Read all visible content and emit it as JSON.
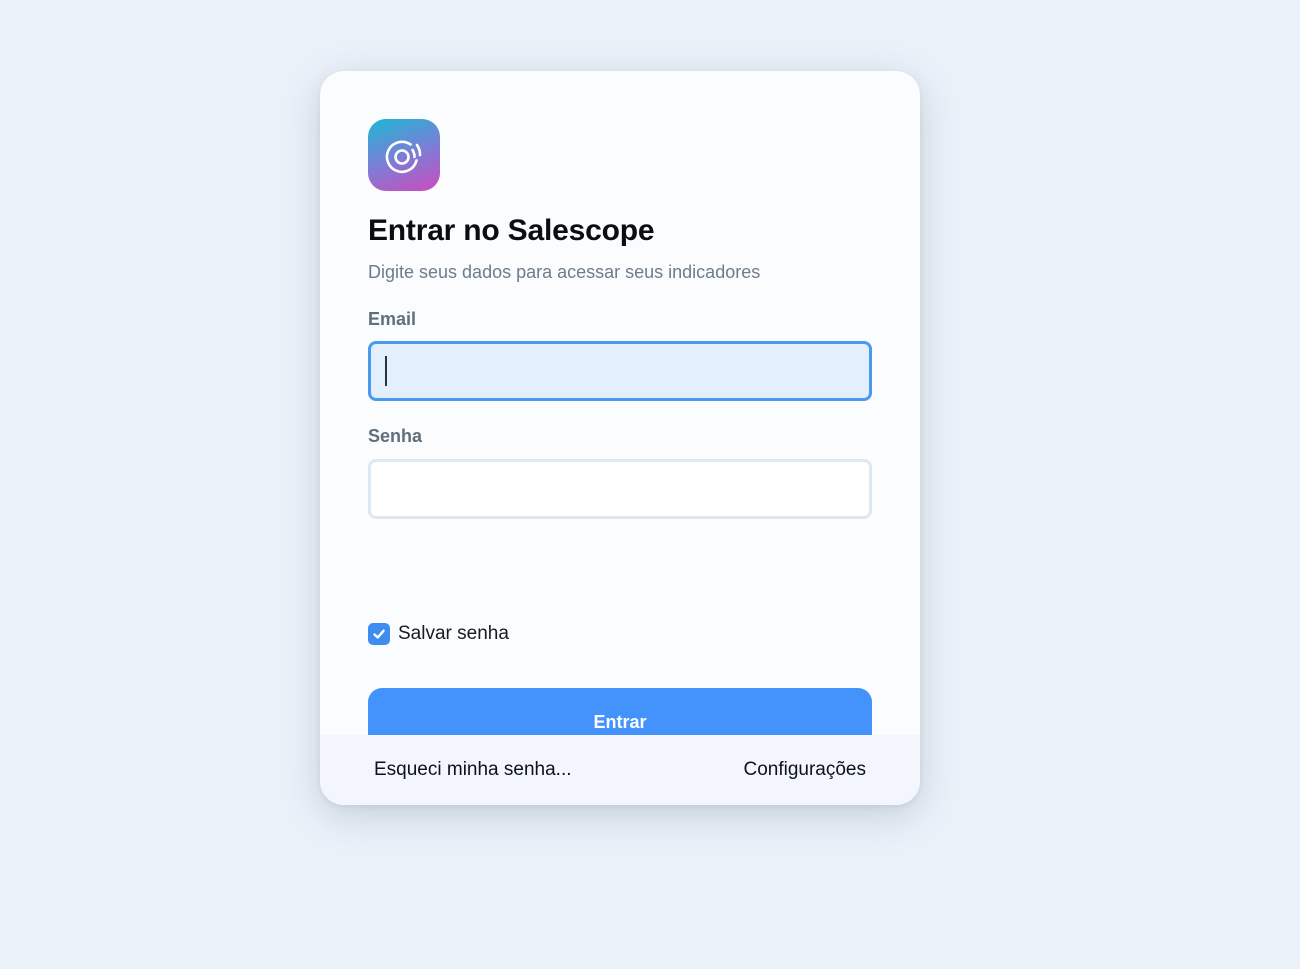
{
  "app": {
    "name": "Salescope",
    "logo_icon": "radar-signal-icon",
    "logo_gradient": [
      "#1cb8d4",
      "#7a7fd6",
      "#cc4bbd"
    ]
  },
  "login": {
    "title": "Entrar no Salescope",
    "subtitle": "Digite seus dados para acessar seus indicadores",
    "email_label": "Email",
    "email_value": "",
    "password_label": "Senha",
    "password_value": "",
    "remember_label": "Salvar senha",
    "remember_checked": true,
    "submit_label": "Entrar"
  },
  "footer": {
    "forgot_label": "Esqueci minha senha...",
    "settings_label": "Configurações"
  },
  "colors": {
    "accent": "#4493fc",
    "page_background": "#ebf1f9",
    "focus_border": "#4b9af0"
  }
}
